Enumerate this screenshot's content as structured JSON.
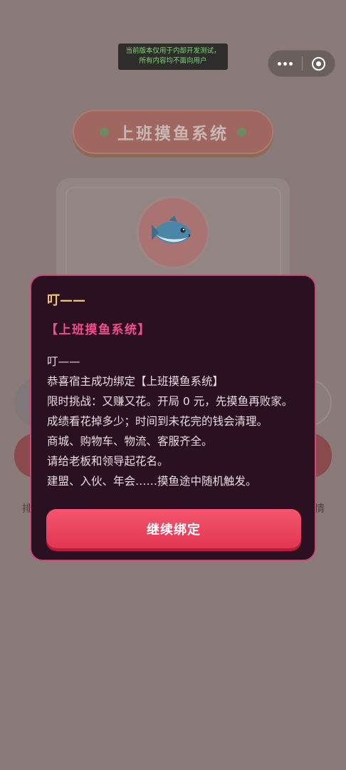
{
  "dev_banner": {
    "line1": "当前版本仅用于内部开发测试，",
    "line2": "所有内容均不面向用户"
  },
  "background": {
    "title": "上班摸鱼系统",
    "left_label": "排",
    "right_label": "情"
  },
  "modal": {
    "title": "叮——",
    "system_name": "【上班摸鱼系统】",
    "lines": [
      "叮——",
      "恭喜宿主成功绑定【上班摸鱼系统】",
      "限时挑战：又赚又花。开局 0 元，先摸鱼再败家。",
      "成绩看花掉多少；时间到未花完的钱会清理。",
      "商城、购物车、物流、客服齐全。",
      "请给老板和领导起花名。",
      "建盟、入伙、年会……摸鱼途中随机触发。"
    ],
    "button_label": "继续绑定"
  },
  "icons": {
    "fish": "fish-icon",
    "more": "more-dots-icon",
    "close": "close-target-icon"
  },
  "colors": {
    "overlay": "#8a7a79",
    "modal_bg": "#2a1020",
    "modal_border": "#c84a7a",
    "accent_pink": "#f0508a",
    "title_gold": "#f0c37a",
    "button_red": "#e23652"
  }
}
